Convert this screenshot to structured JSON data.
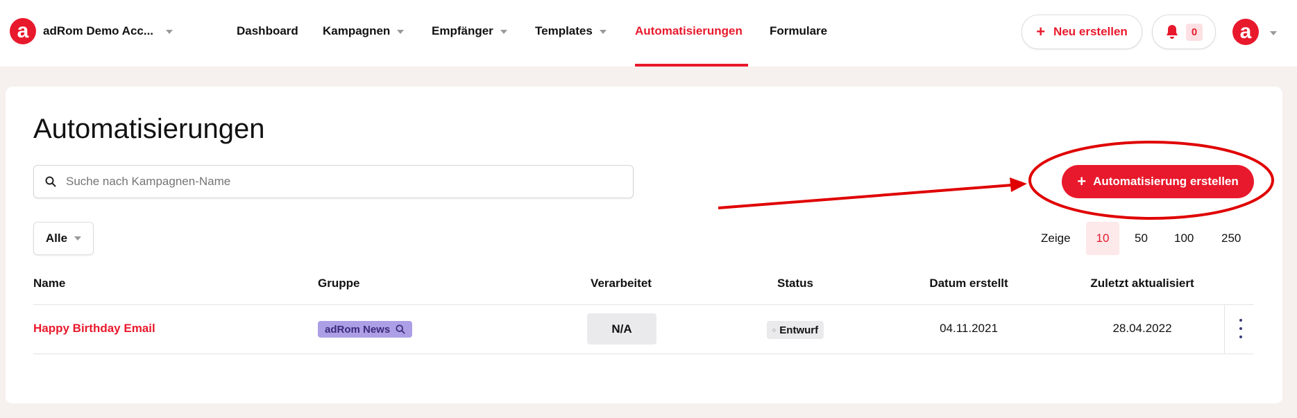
{
  "nav": {
    "account": "adRom Demo Acc...",
    "logo_letter": "a",
    "items": [
      {
        "label": "Dashboard"
      },
      {
        "label": "Kampagnen"
      },
      {
        "label": "Empfänger"
      },
      {
        "label": "Templates"
      },
      {
        "label": "Automatisierungen",
        "active": true
      },
      {
        "label": "Formulare"
      }
    ],
    "new_button": "Neu erstellen",
    "notifications": "0",
    "accent": "#e8192c"
  },
  "page": {
    "title": "Automatisierungen",
    "search_placeholder": "Suche nach Kampagnen-Name",
    "create_button": "Automatisierung erstellen",
    "filter": "Alle",
    "page_size": {
      "label": "Zeige",
      "options": [
        "10",
        "50",
        "100",
        "250"
      ],
      "selected": "10"
    }
  },
  "table": {
    "columns": [
      "Name",
      "Gruppe",
      "Verarbeitet",
      "Status",
      "Datum erstellt",
      "Zuletzt aktualisiert"
    ],
    "rows": [
      {
        "name": "Happy Birthday Email",
        "group": "adRom News",
        "processed": "N/A",
        "status": "Entwurf",
        "created": "04.11.2021",
        "updated": "28.04.2022"
      }
    ]
  }
}
